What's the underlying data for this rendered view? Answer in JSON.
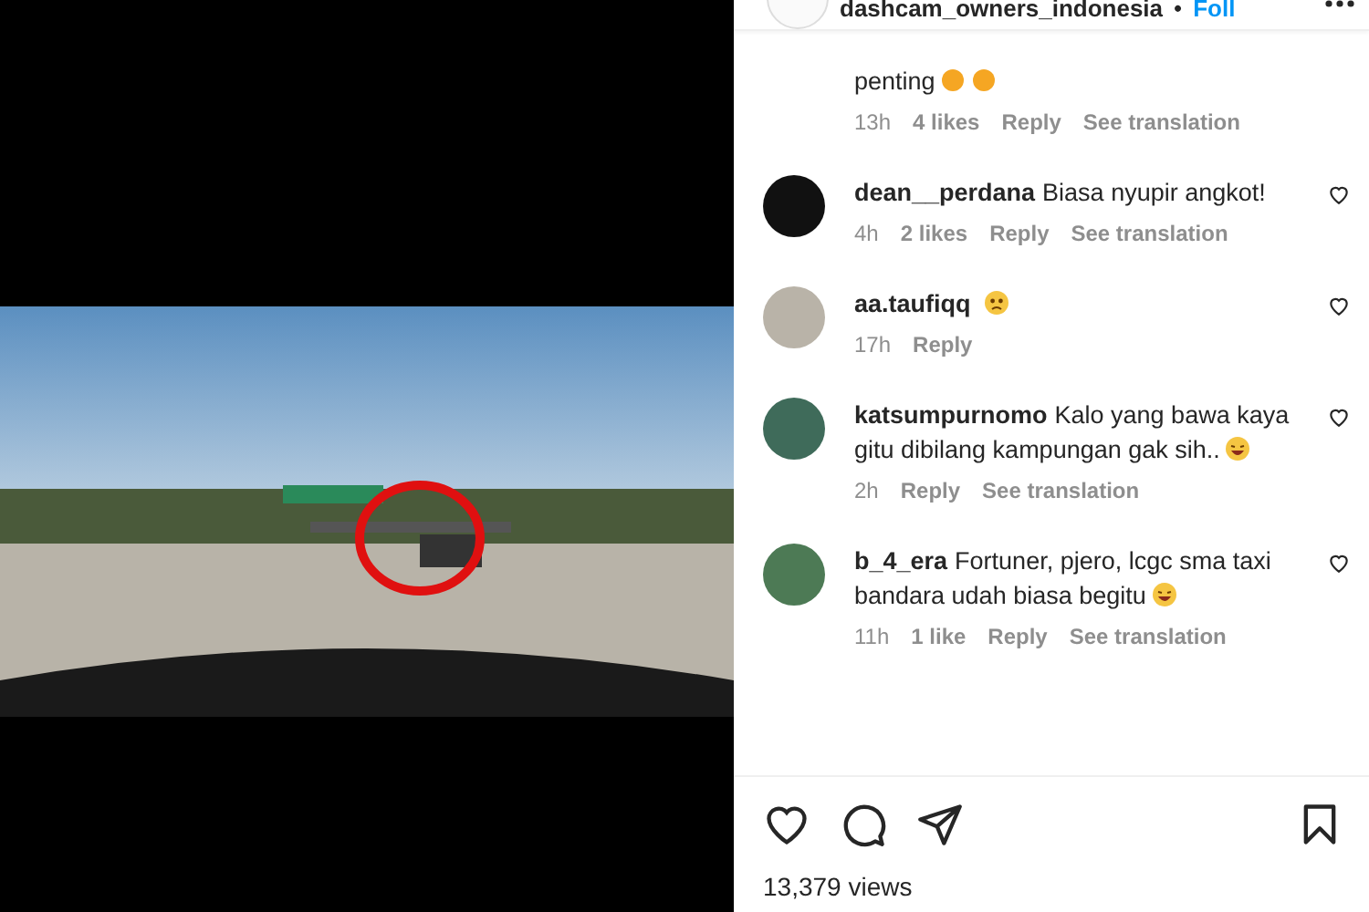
{
  "header": {
    "username": "dashcam_owners_indonesia",
    "separator": "•",
    "follow": "Foll"
  },
  "comments": [
    {
      "kind": "partial",
      "text": "penting",
      "emojis": [
        {
          "kind": "orange"
        },
        {
          "kind": "orange"
        }
      ],
      "time": "13h",
      "likes": "4 likes",
      "reply": "Reply",
      "translation": "See translation"
    },
    {
      "kind": "comment",
      "username": "dean__perdana",
      "text": "Biasa nyupir angkot!",
      "time": "4h",
      "likes": "2 likes",
      "reply": "Reply",
      "translation": "See translation"
    },
    {
      "kind": "comment",
      "username": "aa.taufiqq",
      "emojis": [
        {
          "kind": "sad"
        }
      ],
      "time": "17h",
      "reply": "Reply"
    },
    {
      "kind": "comment",
      "username": "katsumpurnomo",
      "text": "Kalo yang bawa kaya gitu dibilang kampungan gak sih..",
      "emojis": [
        {
          "kind": "laugh"
        }
      ],
      "time": "2h",
      "reply": "Reply",
      "translation": "See translation"
    },
    {
      "kind": "comment",
      "username": "b_4_era",
      "text": "Fortuner, pjero, lcgc sma taxi bandara udah biasa begitu",
      "emojis": [
        {
          "kind": "laugh"
        }
      ],
      "time": "11h",
      "likes": "1 like",
      "reply": "Reply",
      "translation": "See translation"
    }
  ],
  "views": "13,379 views"
}
